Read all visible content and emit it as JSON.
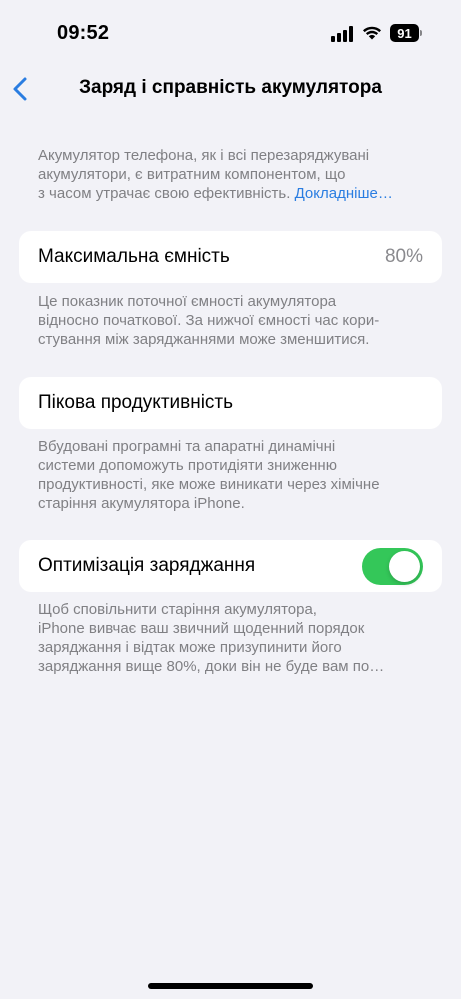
{
  "status_bar": {
    "time": "09:52",
    "battery_level": "91",
    "signal_icon": "cellular-signal-icon",
    "wifi_icon": "wifi-icon"
  },
  "nav": {
    "back_icon": "chevron-left-icon",
    "title": "Заряд і справність акумулятора"
  },
  "intro_note": {
    "lines": [
      "Акумулятор телефона, як і всі перезаряджувані",
      "акумулятори, є витратним компонентом, що",
      "з часом утрачає свою ефективність."
    ],
    "link": "Докладніше…"
  },
  "max_capacity": {
    "label": "Максимальна ємність",
    "value": "80%",
    "note_lines": [
      "Це показник поточної ємності акумулятора",
      "відносно початкової. За нижчої ємності час кори-",
      "стування між заряджаннями може зменшитися."
    ]
  },
  "peak_performance": {
    "label": "Пікова продуктивність",
    "note_lines": [
      "Вбудовані програмні та апаратні динамічні",
      "системи допоможуть протидіяти зниженню",
      "продуктивності, яке може виникати через хімічне",
      "старіння акумулятора iPhone."
    ]
  },
  "optimized_charging": {
    "label": "Оптимізація заряджання",
    "enabled": true,
    "accent_color": "#34c759",
    "note_lines": [
      "Щоб сповільнити старіння акумулятора,",
      "iPhone вивчає ваш звичний щоденний порядок",
      "заряджання і відтак може призупинити його",
      "заряджання вище 80%, доки він не буде вам по…"
    ]
  }
}
